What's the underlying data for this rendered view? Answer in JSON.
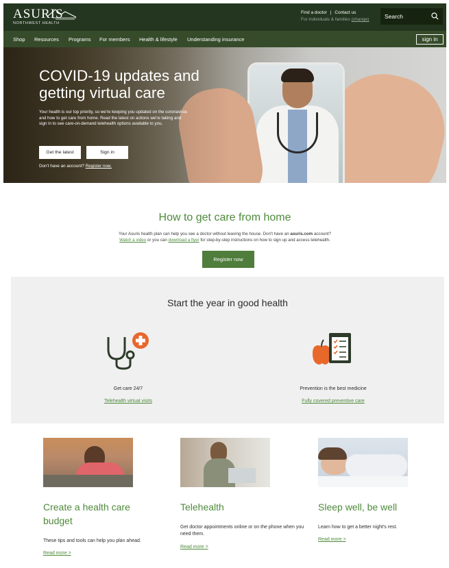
{
  "header": {
    "brand": "ASURIS",
    "brand_sub": "NORTHWEST HEALTH",
    "find_doctor": "Find a doctor",
    "separator": "|",
    "contact_us": "Contact us",
    "audience_prefix": "For individuals & families",
    "audience_change": "(change)",
    "search_placeholder": "Search"
  },
  "nav": {
    "items": [
      "Shop",
      "Resources",
      "Programs",
      "For members",
      "Health & lifestyle",
      "Understanding insurance"
    ],
    "sign_in": "sign in"
  },
  "hero": {
    "title": "COVID-19 updates and getting virtual care",
    "lead": "Your health is our top priority, so we're keeping you updated on the coronavirus and how to get care from home. Read the latest on actions we're taking and sign in to see care-on-demand telehealth options available to you.",
    "btn_latest": "Get the latest",
    "btn_signin": "Sign in",
    "account_text": "Don't have an account?",
    "register_link": "Register now."
  },
  "care": {
    "title": "How to get care from home",
    "line1_pre": "Your Asuris health plan can help you see a doctor without leaving the house. Don't have an",
    "line1_bold": "asuris.com",
    "line1_post": "account?",
    "watch_video": "Watch a video",
    "line2_mid": "or you can",
    "download_flyer": "download a flyer",
    "line2_post": "for step-by-step instructions on how to sign up and access telehealth.",
    "register_btn": "Register now"
  },
  "good_health": {
    "title": "Start the year in good health",
    "items": [
      {
        "label": "Get care 24/7",
        "link": "Telehealth virtual visits",
        "icon": "stethoscope-plus-icon"
      },
      {
        "label": "Prevention is the best medicine",
        "link": "Fully covered preventive care",
        "icon": "apple-checklist-icon"
      }
    ]
  },
  "cards": [
    {
      "title": "Create a health care budget",
      "text": "These tips and tools can help you plan ahead.",
      "more": "Read more >"
    },
    {
      "title": "Telehealth",
      "text": "Get doctor appointments online or on the phone when you need them.",
      "more": "Read more >"
    },
    {
      "title": "Sleep well, be well",
      "text": "Learn how to get a better night's rest.",
      "more": "Read more >"
    }
  ],
  "colors": {
    "header_dark": "#24361f",
    "nav_green": "#364b2a",
    "accent_green": "#4d8a3a",
    "button_green": "#4f7d3c",
    "orange": "#e8672b"
  }
}
